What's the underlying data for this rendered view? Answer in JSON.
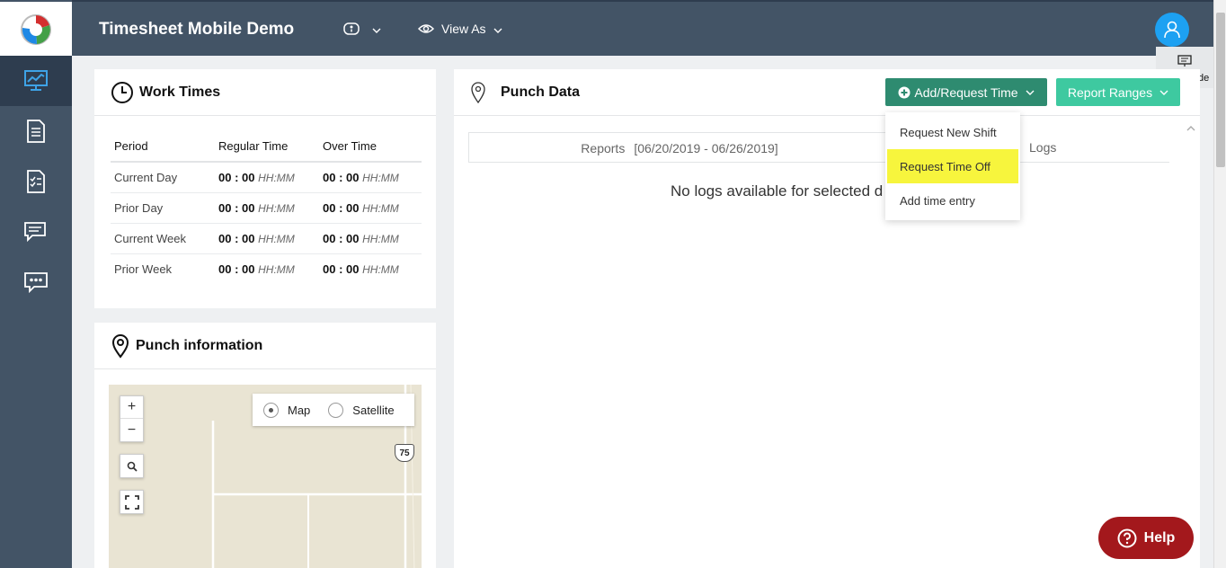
{
  "app": {
    "title": "Timesheet Mobile Demo"
  },
  "topbar": {
    "org_dropdown_icon": "badge-icon",
    "view_as_label": "View As",
    "page_guide_label": "page guide"
  },
  "sidebar": {
    "items": [
      {
        "icon": "dashboard-monitor-icon",
        "active": true
      },
      {
        "icon": "document-icon"
      },
      {
        "icon": "checklist-icon"
      },
      {
        "icon": "chat-icon"
      },
      {
        "icon": "message-more-icon"
      }
    ]
  },
  "work_times": {
    "title": "Work Times",
    "columns": [
      "Period",
      "Regular Time",
      "Over Time"
    ],
    "rows": [
      {
        "period": "Current Day",
        "regular": "00 : 00",
        "overtime": "00 : 00"
      },
      {
        "period": "Prior Day",
        "regular": "00 : 00",
        "overtime": "00 : 00"
      },
      {
        "period": "Current Week",
        "regular": "00 : 00",
        "overtime": "00 : 00"
      },
      {
        "period": "Prior Week",
        "regular": "00 : 00",
        "overtime": "00 : 00"
      }
    ],
    "unit": "HH:MM"
  },
  "punch_info": {
    "title": "Punch information",
    "map": {
      "zoom_in": "+",
      "zoom_out": "−",
      "type_map": "Map",
      "type_satellite": "Satellite",
      "selected": "Map",
      "route_shield": "75"
    }
  },
  "punch_data": {
    "title": "Punch Data",
    "add_request_label": "Add/Request Time",
    "report_ranges_label": "Report Ranges",
    "tab_reports_label": "Reports",
    "tab_reports_range": "[06/20/2019 - 06/26/2019]",
    "tab_logs_label": "Logs",
    "empty_message": "No logs available for selected d",
    "dropdown_items": [
      "Request New Shift",
      "Request Time Off",
      "Add time entry"
    ],
    "highlighted_item": "Request Time Off"
  },
  "help": {
    "label": "Help"
  },
  "colors": {
    "sidebar": "#435466",
    "green_button": "#2e8b70",
    "teal_button": "#3ec9a0",
    "highlight": "#f7f53d",
    "help": "#a3181c",
    "avatar": "#1da1f2"
  }
}
